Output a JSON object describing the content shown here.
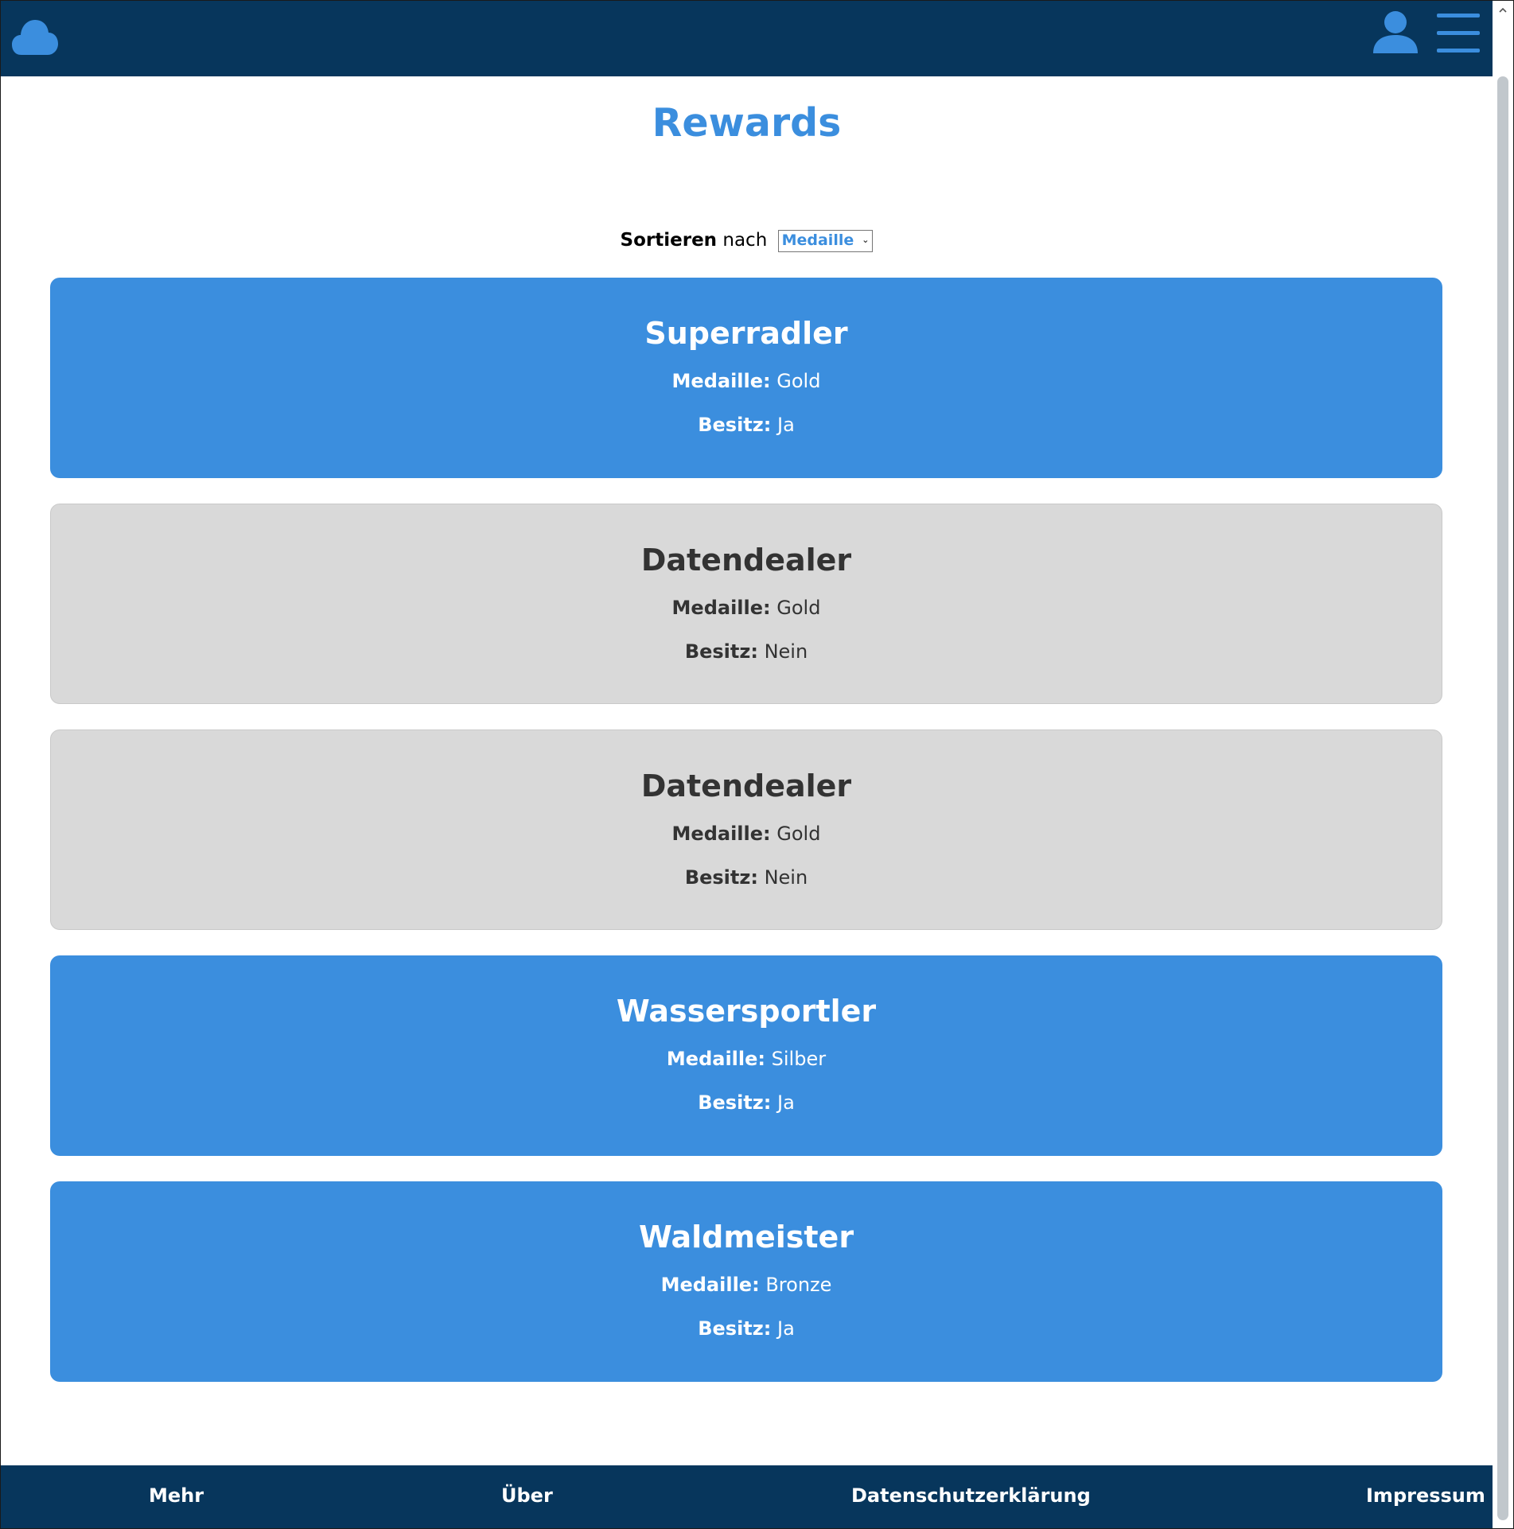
{
  "header": {
    "logo_icon": "cloud-icon",
    "user_icon": "user-icon",
    "menu_icon": "hamburger-menu-icon",
    "colors": {
      "bar": "#07365c",
      "accent": "#3b8ede"
    }
  },
  "page": {
    "title": "Rewards"
  },
  "sort": {
    "label_bold": "Sortieren",
    "label_rest": "nach",
    "selected": "Medaille"
  },
  "labels": {
    "medal": "Medaille:",
    "owned": "Besitz:"
  },
  "rewards": [
    {
      "name": "Superradler",
      "medal": "Gold",
      "owned": "Ja"
    },
    {
      "name": "Datendealer",
      "medal": "Gold",
      "owned": "Nein"
    },
    {
      "name": "Datendealer",
      "medal": "Gold",
      "owned": "Nein"
    },
    {
      "name": "Wassersportler",
      "medal": "Silber",
      "owned": "Ja"
    },
    {
      "name": "Waldmeister",
      "medal": "Bronze",
      "owned": "Ja"
    }
  ],
  "footer": {
    "links": [
      "Mehr",
      "Über",
      "Datenschutzerklärung",
      "Impressum"
    ]
  }
}
